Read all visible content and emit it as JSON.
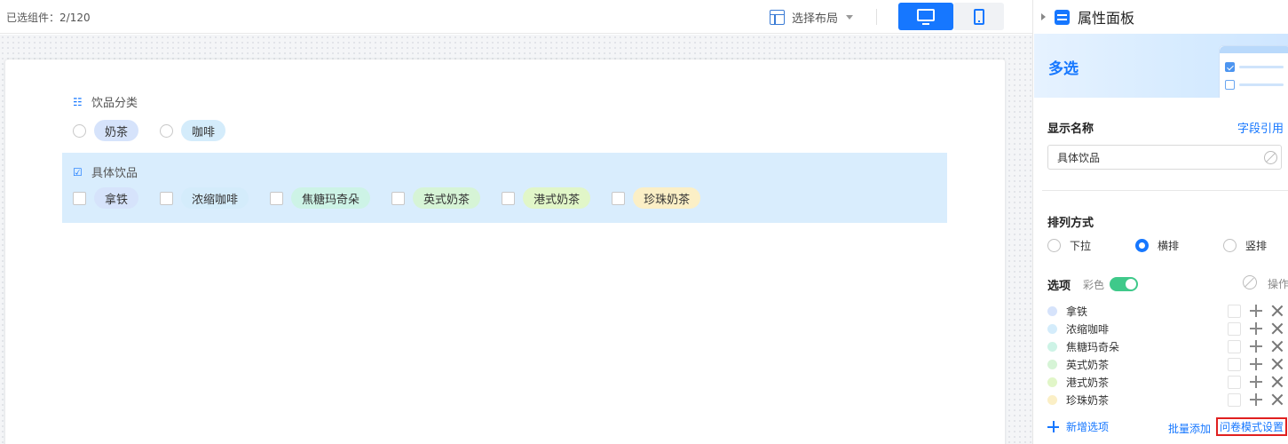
{
  "toolbar": {
    "selected_label": "已选组件：",
    "selected_count": "2/120",
    "layout_select_label": "选择布局",
    "layout_icon": "layout-icon",
    "desktop_icon": "monitor-icon",
    "mobile_icon": "phone-icon",
    "active_device": "desktop",
    "accent_color": "#1677ff"
  },
  "form": {
    "field1": {
      "label": "饮品分类",
      "type": "radio",
      "icon": "list-radio-icon",
      "options": [
        {
          "label": "奶茶",
          "color": "#d6e3fb"
        },
        {
          "label": "咖啡",
          "color": "#d4ecfb"
        }
      ]
    },
    "field2": {
      "label": "具体饮品",
      "type": "checkbox",
      "icon": "list-checkbox-icon",
      "selected": true,
      "highlight_color": "#d9edfd",
      "options": [
        {
          "label": "拿铁",
          "color": "#d6e3fb"
        },
        {
          "label": "浓缩咖啡",
          "color": "#d4ecfb"
        },
        {
          "label": "焦糖玛奇朵",
          "color": "#cdf3e6"
        },
        {
          "label": "英式奶茶",
          "color": "#d6f4d6"
        },
        {
          "label": "港式奶茶",
          "color": "#e1f6c8"
        },
        {
          "label": "珍珠奶茶",
          "color": "#fbefc6"
        }
      ]
    }
  },
  "panel": {
    "title": "属性面板",
    "component_name": "多选",
    "display_name_label": "显示名称",
    "field_ref_link": "字段引用",
    "display_name_value": "具体饮品",
    "arrangement_label": "排列方式",
    "arrangement_options": [
      "下拉",
      "横排",
      "竖排"
    ],
    "arrangement_selected": "横排",
    "options_label": "选项",
    "color_label": "彩色",
    "color_toggle_on": true,
    "operation_label": "操作",
    "options": [
      {
        "label": "拿铁",
        "color": "#d6e3fb"
      },
      {
        "label": "浓缩咖啡",
        "color": "#d4ecfb"
      },
      {
        "label": "焦糖玛奇朵",
        "color": "#cdf3e6"
      },
      {
        "label": "英式奶茶",
        "color": "#d6f4d6"
      },
      {
        "label": "港式奶茶",
        "color": "#e1f6c8"
      },
      {
        "label": "珍珠奶茶",
        "color": "#fbefc6"
      }
    ],
    "add_option_label": "新增选项",
    "batch_add_label": "批量添加",
    "survey_mode_label": "问卷模式设置",
    "survey_mode_highlight_color": "#e02020"
  }
}
